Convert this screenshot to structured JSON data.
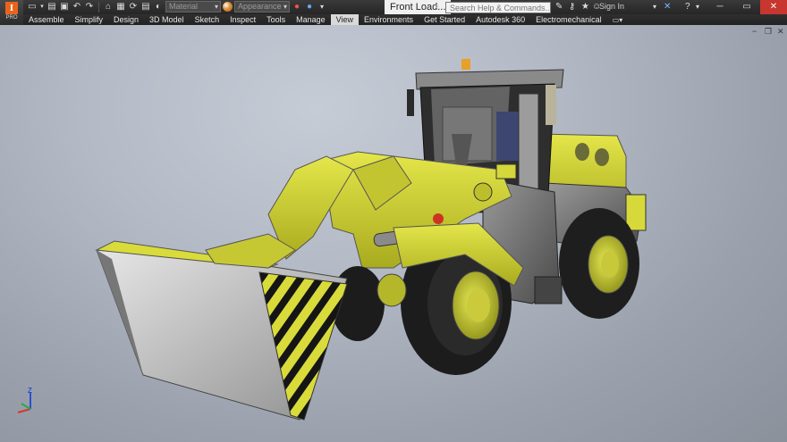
{
  "app": {
    "logo_letter": "I",
    "logo_sub": "PRO"
  },
  "quick_access": {
    "material_placeholder": "Material",
    "appearance_placeholder": "Appearance"
  },
  "document": {
    "title": "Front Load..."
  },
  "search": {
    "placeholder": "Search Help & Commands..."
  },
  "account": {
    "signin_label": "Sign In"
  },
  "ribbon": {
    "tabs": [
      {
        "label": "Assemble",
        "active": false
      },
      {
        "label": "Simplify",
        "active": false
      },
      {
        "label": "Design",
        "active": false
      },
      {
        "label": "3D Model",
        "active": false
      },
      {
        "label": "Sketch",
        "active": false
      },
      {
        "label": "Inspect",
        "active": false
      },
      {
        "label": "Tools",
        "active": false
      },
      {
        "label": "Manage",
        "active": false
      },
      {
        "label": "View",
        "active": true
      },
      {
        "label": "Environments",
        "active": false
      },
      {
        "label": "Get Started",
        "active": false
      },
      {
        "label": "Autodesk 360",
        "active": false
      },
      {
        "label": "Electromechanical",
        "active": false
      }
    ]
  },
  "triad": {
    "z_label": "Z"
  },
  "colors": {
    "body_yellow": "#d6d83a",
    "dark_gray": "#3a3a3a",
    "tire_black": "#1e1e1e",
    "accent_orange": "#e8641b",
    "close_red": "#c7372f"
  }
}
